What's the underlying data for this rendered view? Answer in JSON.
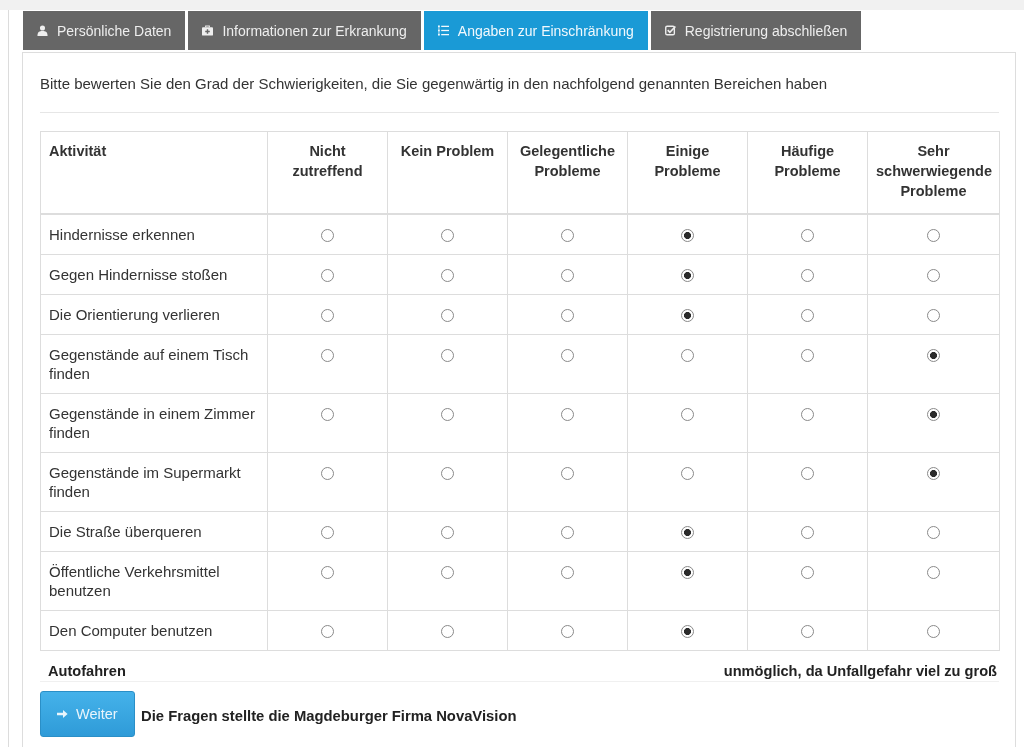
{
  "tabs": [
    {
      "label": "Persönliche Daten",
      "selected": false
    },
    {
      "label": "Informationen zur Erkrankung",
      "selected": false
    },
    {
      "label": "Angaben zur Einschränkung",
      "selected": true
    },
    {
      "label": "Registrierung abschließen",
      "selected": false
    }
  ],
  "intro": "Bitte bewerten Sie den Grad der Schwierigkeiten, die Sie gegenwärtig in den nachfolgend genannten Bereichen haben",
  "table": {
    "columns": [
      "Aktivität",
      "Nicht zutreffend",
      "Kein Problem",
      "Gelegentliche Probleme",
      "Einige Probleme",
      "Häufige Probleme",
      "Sehr schwerwiegende Probleme"
    ],
    "rows": [
      {
        "activity": "Hindernisse erkennen",
        "options": [
          {
            "selected": false
          },
          {
            "selected": false
          },
          {
            "selected": false
          },
          {
            "selected": true
          },
          {
            "selected": false
          },
          {
            "selected": false
          }
        ]
      },
      {
        "activity": "Gegen Hindernisse stoßen",
        "options": [
          {
            "selected": false
          },
          {
            "selected": false
          },
          {
            "selected": false
          },
          {
            "selected": true
          },
          {
            "selected": false
          },
          {
            "selected": false
          }
        ]
      },
      {
        "activity": "Die Orientierung verlieren",
        "options": [
          {
            "selected": false
          },
          {
            "selected": false
          },
          {
            "selected": false
          },
          {
            "selected": true
          },
          {
            "selected": false
          },
          {
            "selected": false
          }
        ]
      },
      {
        "activity": "Gegenstände auf einem Tisch finden",
        "options": [
          {
            "selected": false
          },
          {
            "selected": false
          },
          {
            "selected": false
          },
          {
            "selected": false
          },
          {
            "selected": false
          },
          {
            "selected": true
          }
        ]
      },
      {
        "activity": "Gegenstände in einem Zimmer finden",
        "options": [
          {
            "selected": false
          },
          {
            "selected": false
          },
          {
            "selected": false
          },
          {
            "selected": false
          },
          {
            "selected": false
          },
          {
            "selected": true
          }
        ]
      },
      {
        "activity": "Gegenstände im Supermarkt finden",
        "options": [
          {
            "selected": false
          },
          {
            "selected": false
          },
          {
            "selected": false
          },
          {
            "selected": false
          },
          {
            "selected": false
          },
          {
            "selected": true
          }
        ]
      },
      {
        "activity": "Die Straße überqueren",
        "options": [
          {
            "selected": false
          },
          {
            "selected": false
          },
          {
            "selected": false
          },
          {
            "selected": true
          },
          {
            "selected": false
          },
          {
            "selected": false
          }
        ]
      },
      {
        "activity": "Öffentliche Verkehrsmittel benutzen",
        "options": [
          {
            "selected": false
          },
          {
            "selected": false
          },
          {
            "selected": false
          },
          {
            "selected": true
          },
          {
            "selected": false
          },
          {
            "selected": false
          }
        ]
      },
      {
        "activity": "Den Computer benutzen",
        "options": [
          {
            "selected": false
          },
          {
            "selected": false
          },
          {
            "selected": false
          },
          {
            "selected": true
          },
          {
            "selected": false
          },
          {
            "selected": false
          }
        ]
      }
    ]
  },
  "extra_row": {
    "activity": "Autofahren",
    "note": "unmöglich, da Unfallgefahr viel zu groß"
  },
  "button": {
    "label": "Weiter"
  },
  "credit": "Die Fragen stellte die Magdeburger Firma NovaVision"
}
